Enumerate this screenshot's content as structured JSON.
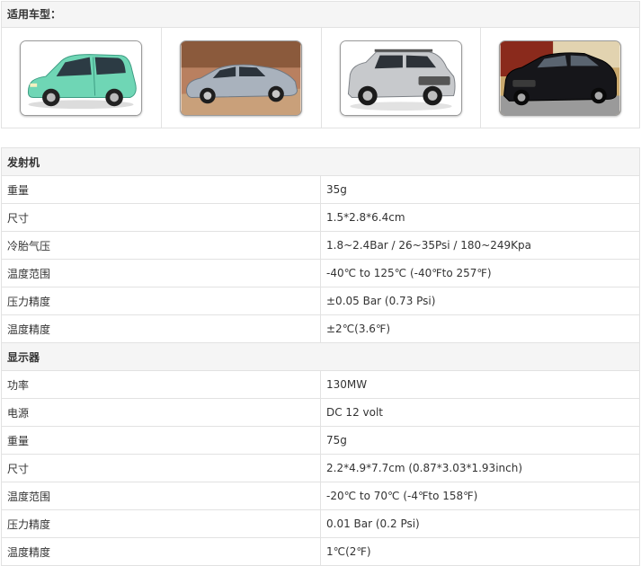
{
  "header": {
    "title": "适用车型："
  },
  "cars": [
    {
      "icon": "green-hatchback-car",
      "color": "#6fd6b5"
    },
    {
      "icon": "silver-sedan-car",
      "color": "#a9b2bd"
    },
    {
      "icon": "silver-suv-car",
      "color": "#c7c9cc"
    },
    {
      "icon": "black-sedan-car",
      "color": "#16161a"
    }
  ],
  "sections": [
    {
      "title": "发射机",
      "rows": [
        {
          "label": "重量",
          "value": "35g"
        },
        {
          "label": "尺寸",
          "value": " 1.5*2.8*6.4cm"
        },
        {
          "label": "冷胎气压",
          "value": "1.8~2.4Bar / 26~35Psi / 180~249Kpa"
        },
        {
          "label": "温度范围",
          "value": "-40℃ to 125℃ (-40℉to 257℉)"
        },
        {
          "label": "压力精度",
          "value": "±0.05 Bar (0.73 Psi)"
        },
        {
          "label": "温度精度",
          "value": "±2℃(3.6℉)"
        }
      ]
    },
    {
      "title": "显示器",
      "rows": [
        {
          "label": "功率",
          "value": "130MW"
        },
        {
          "label": "电源",
          "value": "DC 12 volt"
        },
        {
          "label": "重量",
          "value": "75g"
        },
        {
          "label": "尺寸",
          "value": "2.2*4.9*7.7cm (0.87*3.03*1.93inch)"
        },
        {
          "label": "温度范围",
          "value": "-20℃ to 70℃ (-4℉to 158℉)"
        },
        {
          "label": "压力精度",
          "value": "0.01 Bar (0.2 Psi)"
        },
        {
          "label": "温度精度",
          "value": "1℃(2℉)"
        }
      ]
    }
  ]
}
